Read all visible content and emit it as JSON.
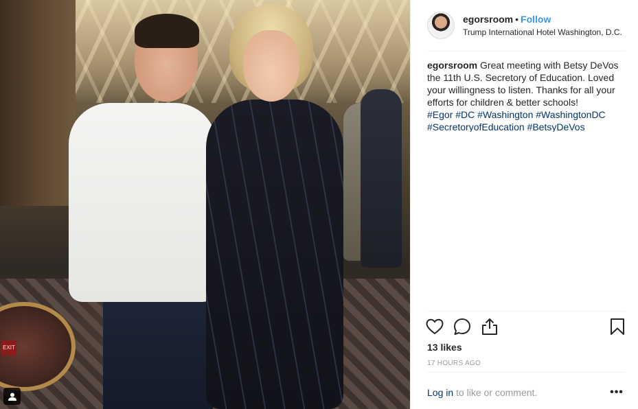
{
  "post": {
    "username": "egorsroom",
    "separator": "•",
    "follow_label": "Follow",
    "location": "Trump International Hotel Washington, D.C.",
    "caption": {
      "username": "egorsroom",
      "text": "Great meeting with Betsy DeVos the 11th U.S. Secretory of Education. Loved your willingness to listen. Thanks for all your efforts for children & better schools!",
      "hashtags": [
        "#Egor",
        "#DC",
        "#Washington",
        "#WashingtonDC",
        "#SecretoryofEducation",
        "#BetsyDeVos"
      ]
    },
    "likes": "13 likes",
    "time": "17 HOURS AGO",
    "login_link": "Log in",
    "login_suffix": " to like or comment.",
    "more": "•••"
  },
  "photo": {
    "exit_sign": "EXIT"
  },
  "icons": {
    "like": "heart-icon",
    "comment": "comment-icon",
    "share": "share-icon",
    "save": "bookmark-icon",
    "tagged_user": "user-icon"
  },
  "colors": {
    "link_blue": "#3897f0",
    "hashtag_navy": "#003569",
    "muted_gray": "#999999",
    "text_dark": "#262626"
  }
}
